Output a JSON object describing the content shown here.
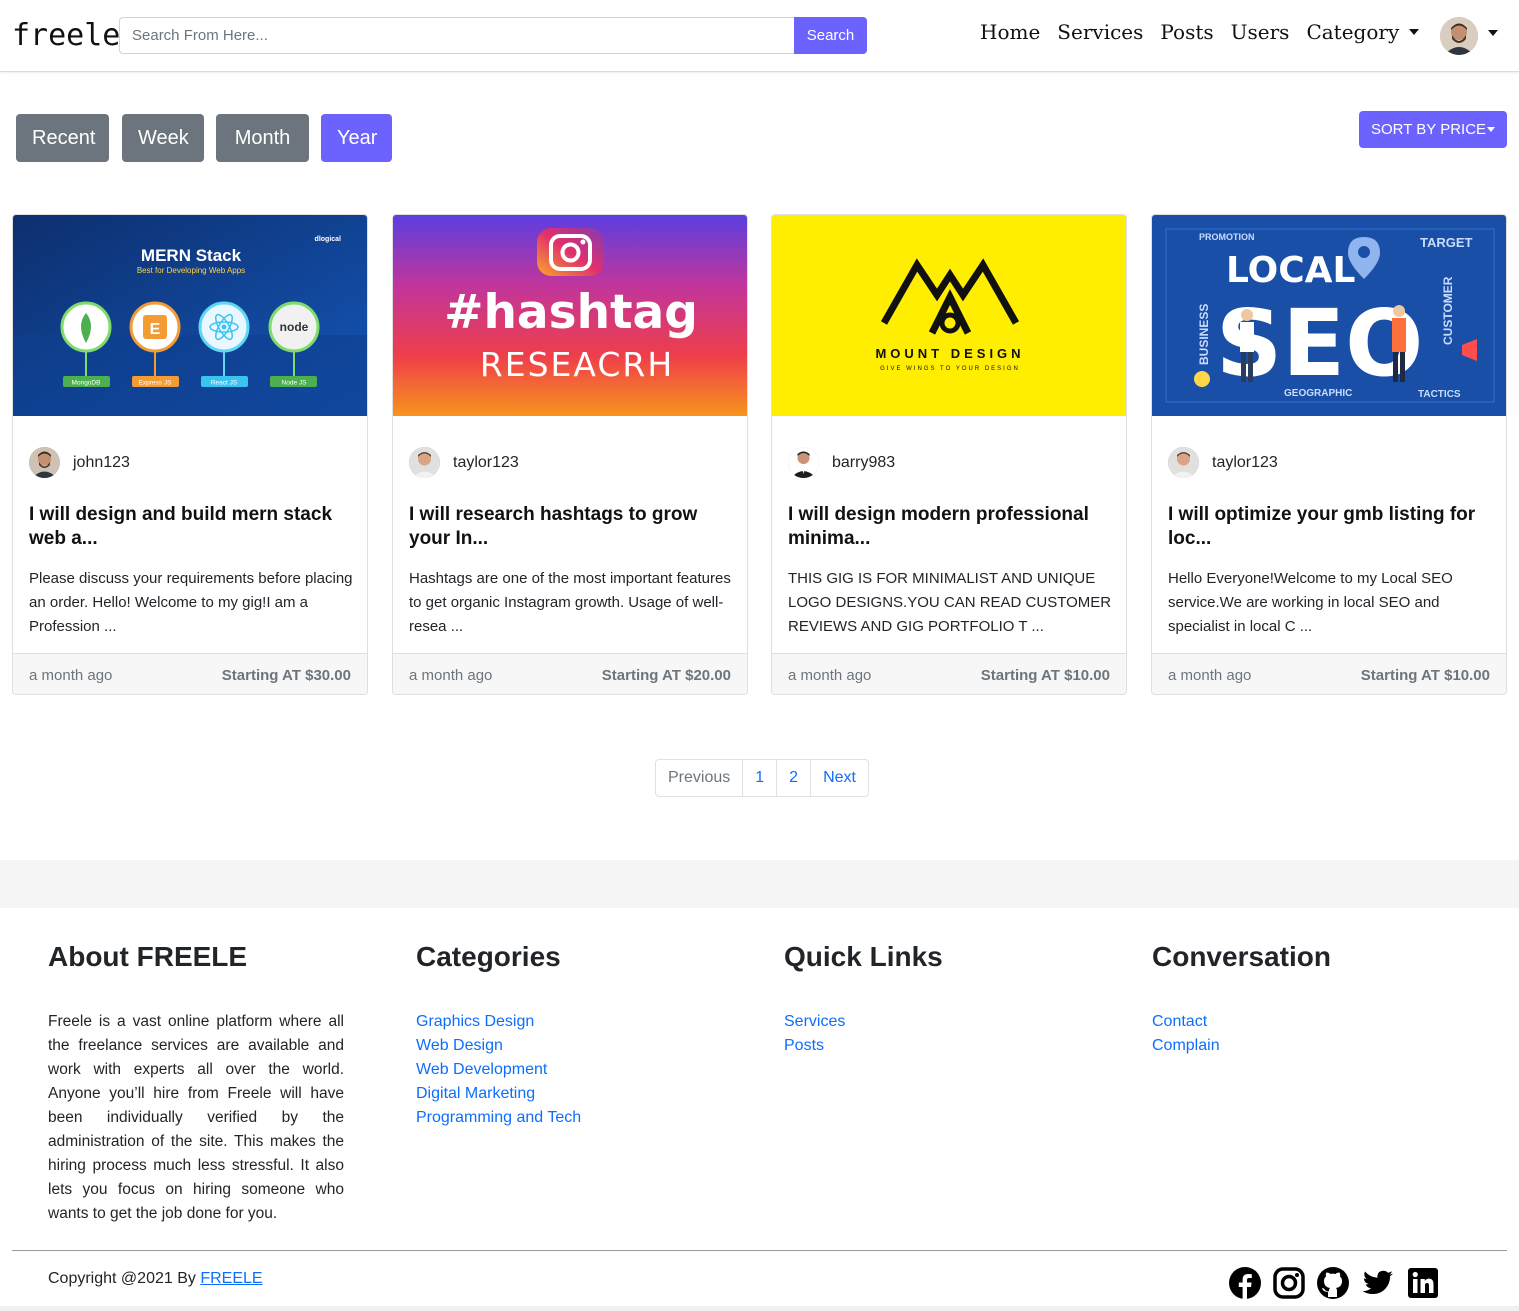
{
  "nav": {
    "brand": "freele",
    "search_placeholder": "Search From Here...",
    "search_button": "Search",
    "links": [
      "Home",
      "Services",
      "Posts",
      "Users",
      "Category"
    ]
  },
  "filters": {
    "buttons": [
      "Recent",
      "Week",
      "Month",
      "Year"
    ],
    "active": "Year",
    "sort_label": "SORT BY PRICE"
  },
  "cards": [
    {
      "image_text": [
        "MERN Stack",
        "Best for Developing Web Apps",
        "MongoDB",
        "Express JS",
        "React JS",
        "Node JS",
        "dlogical"
      ],
      "user": "john123",
      "title": "I will design and build mern stack web a...",
      "desc": "Please discuss your requirements before placing an order. Hello! Welcome to my gig!I am a Profession ...",
      "time": "a month ago",
      "price": "Starting AT $30.00"
    },
    {
      "image_text": [
        "#hashtag",
        "RESEACRH"
      ],
      "user": "taylor123",
      "title": "I will research hashtags to grow your In...",
      "desc": "Hashtags are one of the most important features to get organic Instagram growth. Usage of well-resea ...",
      "time": "a month ago",
      "price": "Starting AT $20.00"
    },
    {
      "image_text": [
        "MOUNT DESIGN",
        "GIVE WINGS TO YOUR DESIGN"
      ],
      "user": "barry983",
      "title": "I will design modern professional minima...",
      "desc": "THIS GIG IS FOR MINIMALIST AND UNIQUE LOGO DESIGNS.YOU CAN READ CUSTOMER REVIEWS AND GIG PORTFOLIO T ...",
      "time": "a month ago",
      "price": "Starting AT $10.00"
    },
    {
      "image_text": [
        "LOCAL",
        "SEO",
        "PROMOTION",
        "TARGET",
        "BUSINESS",
        "CUSTOMER",
        "GEOGRAPHIC",
        "TACTICS"
      ],
      "user": "taylor123",
      "title": "I will optimize your gmb listing for loc...",
      "desc": "Hello Everyone!Welcome to my Local SEO service.We are working in local SEO and specialist in local C ...",
      "time": "a month ago",
      "price": "Starting AT $10.00"
    }
  ],
  "pagination": [
    "Previous",
    "1",
    "2",
    "Next"
  ],
  "footer": {
    "about_title": "About FREELE",
    "about_text": "Freele is a vast online platform where all the freelance services are available and work with experts all over the world. Anyone you’ll hire from Freele will have been individually verified by the administration of the site. This makes the hiring process much less stressful. It also lets you focus on hiring someone who wants to get the job done for you.",
    "categories_title": "Categories",
    "categories": [
      "Graphics Design",
      "Web Design",
      "Web Development",
      "Digital Marketing",
      "Programming and Tech"
    ],
    "quick_title": "Quick Links",
    "quick": [
      "Services",
      "Posts"
    ],
    "conv_title": "Conversation",
    "conv": [
      "Contact",
      "Complain"
    ],
    "copyright_prefix": "Copyright @2021 By ",
    "copyright_link": "FREELE",
    "social": [
      "facebook-icon",
      "instagram-icon",
      "github-icon",
      "twitter-icon",
      "linkedin-icon"
    ]
  },
  "colors": {
    "accent": "#6c63ff",
    "grey_button": "#6c757d",
    "link": "#0d6efd"
  }
}
